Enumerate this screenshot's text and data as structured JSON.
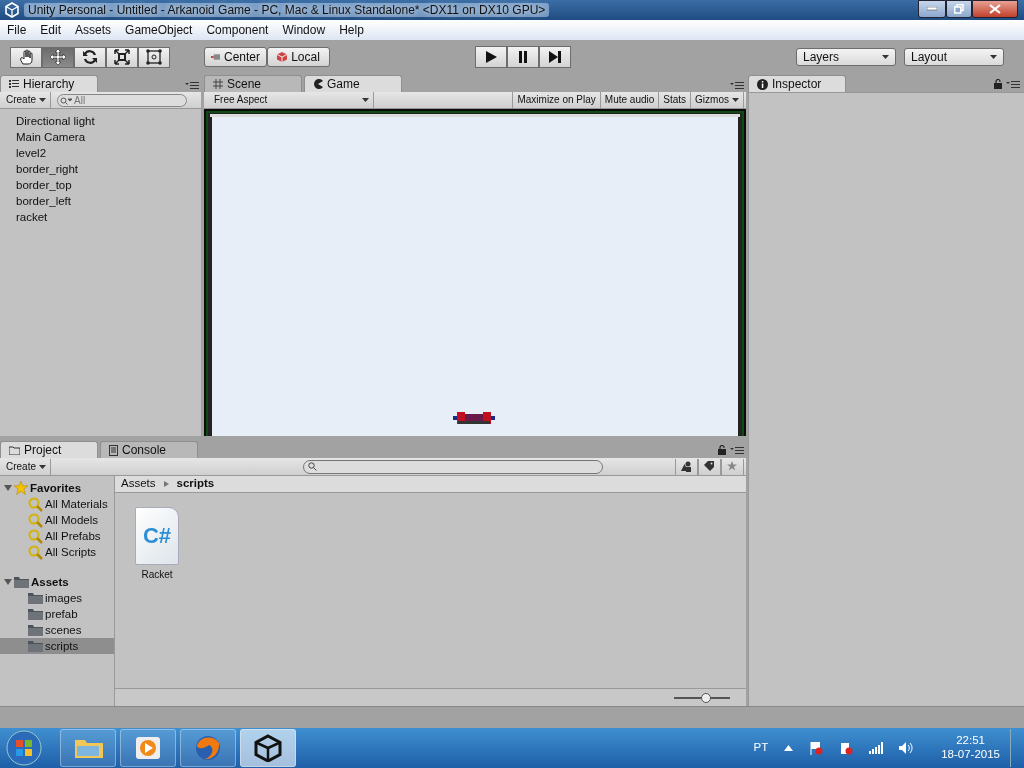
{
  "window": {
    "title": "Unity Personal - Untitled - Arkanoid Game - PC, Mac & Linux Standalone* <DX11 on DX10 GPU>"
  },
  "menu": [
    "File",
    "Edit",
    "Assets",
    "GameObject",
    "Component",
    "Window",
    "Help"
  ],
  "toolbar": {
    "tools": [
      {
        "kind": "hand",
        "selected": false
      },
      {
        "kind": "move",
        "selected": true
      },
      {
        "kind": "rotate",
        "selected": false
      },
      {
        "kind": "scale",
        "selected": false
      },
      {
        "kind": "rect",
        "selected": false
      }
    ],
    "pivot": [
      {
        "kind": "center",
        "label": "Center"
      },
      {
        "kind": "local",
        "label": "Local"
      }
    ],
    "playback": [
      {
        "kind": "play"
      },
      {
        "kind": "pause"
      },
      {
        "kind": "step"
      }
    ],
    "dropdowns": [
      "Layers",
      "Layout"
    ]
  },
  "hierarchy": {
    "title": "Hierarchy",
    "create": "Create",
    "search_placeholder": "All",
    "items": [
      "Directional light",
      "Main Camera",
      "level2",
      "border_right",
      "border_top",
      "border_left",
      "racket"
    ]
  },
  "view_tabs": [
    {
      "kind": "scene",
      "label": "Scene",
      "selected": false
    },
    {
      "kind": "game",
      "label": "Game",
      "selected": true
    }
  ],
  "game_toolbar": {
    "aspect": "Free Aspect",
    "buttons": [
      "Maximize on Play",
      "Mute audio",
      "Stats"
    ],
    "gizmos": "Gizmos"
  },
  "inspector": {
    "title": "Inspector"
  },
  "project": {
    "tabs": [
      {
        "kind": "project",
        "label": "Project",
        "selected": true
      },
      {
        "kind": "console",
        "label": "Console",
        "selected": false
      }
    ],
    "create": "Create",
    "tree": [
      {
        "kind": "favorites",
        "label": "Favorites",
        "expanded": true,
        "children": [
          {
            "label": "All Materials",
            "selected": false
          },
          {
            "label": "All Models",
            "selected": false
          },
          {
            "label": "All Prefabs",
            "selected": false
          },
          {
            "label": "All Scripts",
            "selected": false
          }
        ]
      },
      {
        "kind": "folder",
        "label": "Assets",
        "expanded": true,
        "children": [
          {
            "label": "images",
            "selected": false
          },
          {
            "label": "prefab",
            "selected": false
          },
          {
            "label": "scenes",
            "selected": false
          },
          {
            "label": "scripts",
            "selected": true
          }
        ]
      }
    ],
    "breadcrumb": [
      "Assets",
      "scripts"
    ],
    "files": [
      {
        "kind": "csharp",
        "name": "Racket",
        "icon_text": "C#"
      }
    ],
    "zoom_slider": {
      "level": 0.57
    }
  },
  "taskbar": {
    "apps": [
      {
        "kind": "explorer",
        "selected": false
      },
      {
        "kind": "media",
        "selected": false
      },
      {
        "kind": "browser",
        "selected": false
      },
      {
        "kind": "unity",
        "selected": true
      }
    ],
    "language": "PT",
    "time": "22:51",
    "date": "18-07-2015"
  }
}
